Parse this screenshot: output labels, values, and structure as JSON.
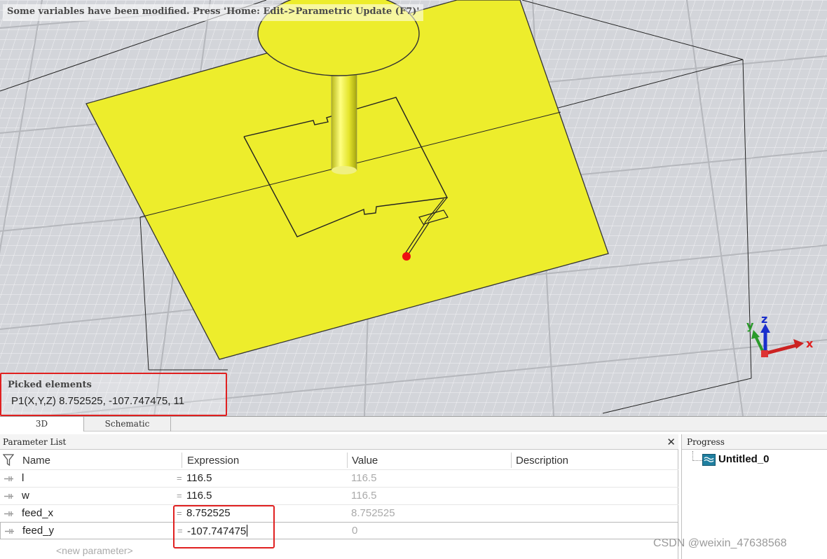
{
  "viewport": {
    "status_message": "Some variables have been modified. Press 'Home: Edit->Parametric Update (F7)'",
    "picked": {
      "title": "Picked elements",
      "value": "P1(X,Y,Z)   8.752525, -107.747475, 11"
    },
    "axes": {
      "x": "x",
      "y": "y",
      "z": "z"
    },
    "colors": {
      "patch": "#eded2c",
      "background": "#d4d6da",
      "pick_point": "#ee1111",
      "highlight": "#e02020"
    }
  },
  "tabs": [
    {
      "label": "3D",
      "active": true
    },
    {
      "label": "Schematic",
      "active": false
    }
  ],
  "parameter_list": {
    "title": "Parameter List",
    "columns": {
      "name": "Name",
      "expression": "Expression",
      "value": "Value",
      "description": "Description"
    },
    "rows": [
      {
        "name": "l",
        "expression": "116.5",
        "value": "116.5"
      },
      {
        "name": "w",
        "expression": "116.5",
        "value": "116.5"
      },
      {
        "name": "feed_x",
        "expression": "8.752525",
        "value": "8.752525"
      },
      {
        "name": "feed_y",
        "expression": "-107.747475",
        "value": "0"
      }
    ],
    "new_parameter_placeholder": "<new parameter>"
  },
  "progress": {
    "title": "Progress",
    "project": "Untitled_0"
  },
  "watermark": "CSDN @weixin_47638568"
}
